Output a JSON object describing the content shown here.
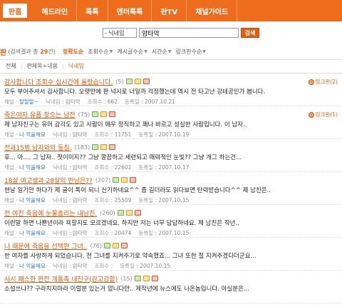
{
  "nav": {
    "tabs": [
      "판홈",
      "헤드라인",
      "톡톡",
      "엔터톡톡",
      "판TV",
      "채널가이드"
    ]
  },
  "search": {
    "field_option": "- 닉네임",
    "query": "암타악",
    "button": "검색"
  },
  "sort": {
    "pan": "판",
    "result_prefix": "(검색결과 총 ",
    "result_count": "29",
    "result_suffix": "건)",
    "options": [
      "정확도순",
      "조회수순",
      "게시글수순",
      "시간순",
      "링크판수순"
    ]
  },
  "filters": [
    "전체",
    "판제목+내용",
    "닉네임"
  ],
  "labels": {
    "channel": "채널 ·",
    "nickname": "닉네임",
    "views": "조회수",
    "date": "등록일",
    "linkcup": "링크판"
  },
  "items": [
    {
      "title": "감사합니다 조회수 십시간에 올랐습니다.",
      "count": "(5)",
      "snippet": "모두 부어주셔서 감사합니다. 오랫만에 판 넉시로 너일까 걱정했는데 역시 전 타고난 강테공인가 봅니다.",
      "channel": "탈탈탈~",
      "author": "암타악",
      "views": "662",
      "date": "2007.10.21",
      "linkcup": "링크판(2)"
    },
    {
      "title": "죽은여자 유품 찾으는 남전",
      "count": "(75)",
      "snippet": "제 남자친구는 유머 감각도 있고 사람이 매우 정직하고 꽤나 바르고 성실한 사람입니다. 이 남자..",
      "channel": "나 억울해요",
      "author": "암타악",
      "views": "11751",
      "date": "2007.10.19",
      "linkcup": "링크판(1)"
    },
    {
      "title": "전과15범 남자와의 동침.",
      "count": "(183)",
      "snippet": "후... 아.... 그 남자.. 첫이미지?? 그냥 깔끔하고 세련되고 매력적인 눈빛?? 그냥 개그 하는건...",
      "channel": "나 억울해요",
      "author": "암타악",
      "views": "22602",
      "date": "2007.10.17",
      "linkcup": ""
    },
    {
      "title": "18살 여고생과 28살의 만남은??",
      "count": "(207)",
      "snippet": "현날 일기만 하다가 제 글이 톡이 되니 신기하네요^^ 좀 길더라도 읽다보면 탄력받습니다^^ 제 남친은..",
      "channel": "나 억울해요",
      "author": "암타악",
      "views": "25509",
      "date": "2007.10.15",
      "linkcup": ""
    },
    {
      "title": "전 여친 죽음에 눈물흘리는 내남친.",
      "count": "(260)",
      "snippet": "이런말 하면 나쁜년이라 욕할지도 모르겠네요. 하지만 저는 너무 답답하네요. 제 남친은 작년..",
      "channel": "나 억울해요",
      "author": "암타악",
      "views": "20474",
      "date": "2007.10.15",
      "linkcup": ""
    },
    {
      "title": "나 때문에 죽음을 선택한 그녀..",
      "count": "(76)",
      "snippet": "한 여자를 사랑하게 되었습니다. 전 그녀를 지켜주기로 약속했죠... 그녀 또한 절 지켜주겠다더군요...",
      "channel": "나 억울해요",
      "author": "암타악",
      "views": "",
      "date": "2007.10.15",
      "linkcup": ""
    },
    {
      "title": "사시 패스한 완전 개통촉 내친구(감고강함)",
      "count": "(15)",
      "snippet": "소설쓰냐?? 구라치지마라 이럴분 있는거 압니다만.. 제작년에 뉴스에도 나온놈입니다. 아실분은...",
      "channel": "",
      "author": "",
      "views": "",
      "date": "",
      "linkcup": ""
    }
  ],
  "colors": {
    "accent": "#ee6d1d",
    "title": "#d2580e"
  }
}
